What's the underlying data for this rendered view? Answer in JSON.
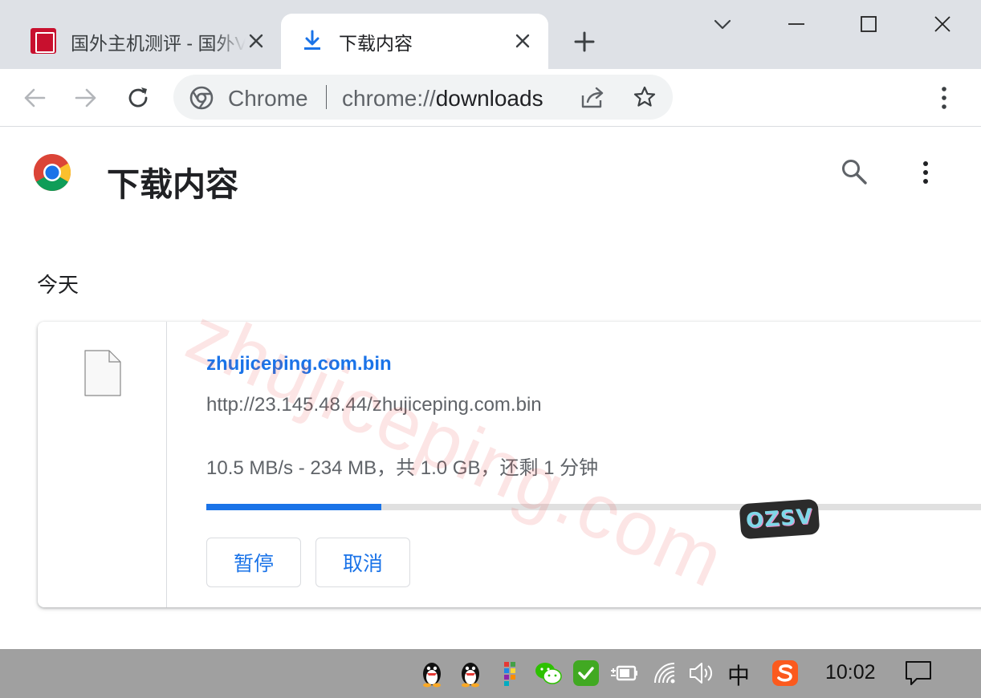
{
  "window": {
    "tabs": [
      {
        "title": "国外主机测评 - 国外VPS，国外服务器",
        "active": false
      },
      {
        "title": "下载内容",
        "active": true
      }
    ]
  },
  "omnibox": {
    "chip": "Chrome",
    "url_scheme": "chrome://",
    "url_host": "downloads"
  },
  "page": {
    "title": "下载内容",
    "section_date": "今天"
  },
  "download": {
    "file_name": "zhujiceping.com.bin",
    "url": "http://23.145.48.44/zhujiceping.com.bin",
    "status": "10.5 MB/s - 234 MB，共 1.0 GB，还剩 1 分钟",
    "progress": 0.22,
    "pause_label": "暂停",
    "cancel_label": "取消"
  },
  "overlays": {
    "watermark": "zhujiceping.com",
    "sticker": "OZSV"
  },
  "taskbar": {
    "ime": "中",
    "time": "10:02"
  },
  "colors": {
    "accent": "#1a73e8",
    "tabstrip": "#dee1e6",
    "taskbar": "#a0a0a0"
  }
}
